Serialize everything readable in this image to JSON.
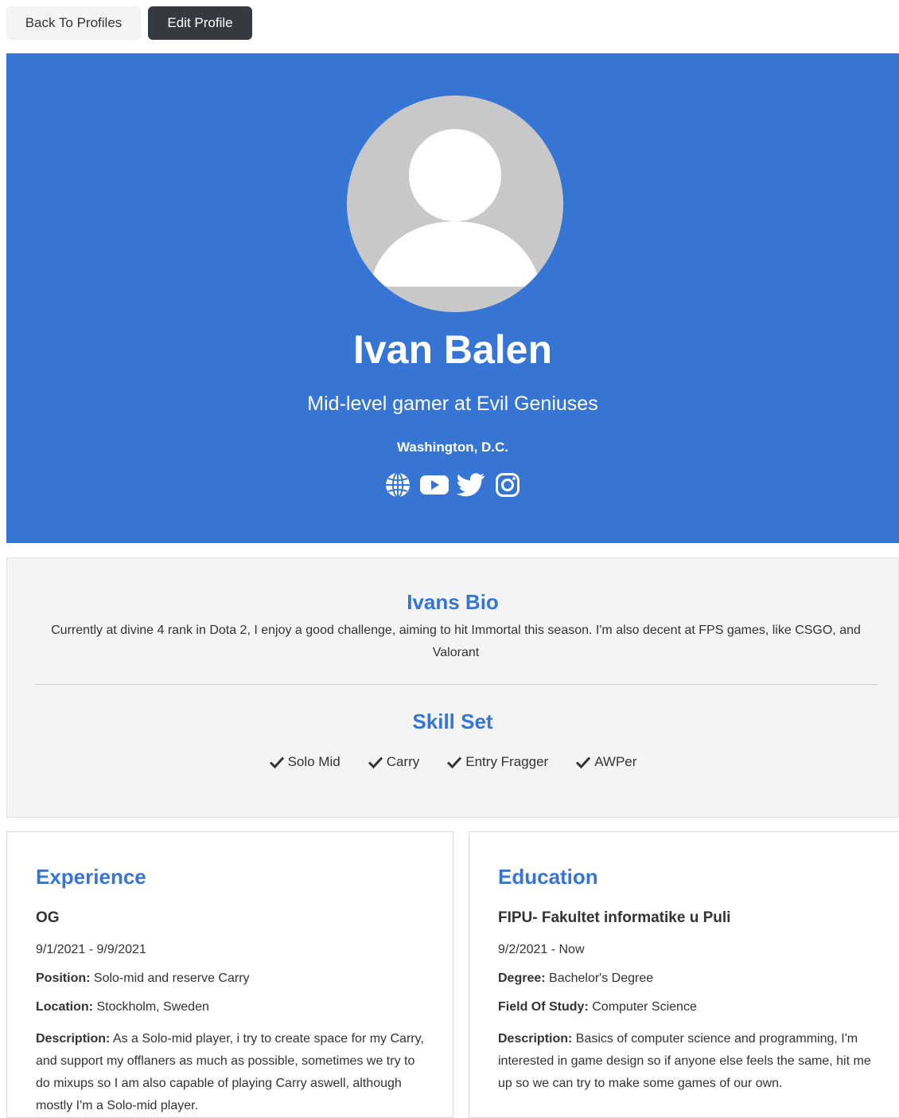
{
  "toolbar": {
    "back_label": "Back To Profiles",
    "edit_label": "Edit Profile"
  },
  "profile": {
    "name": "Ivan Balen",
    "title": "Mid-level gamer at Evil Geniuses",
    "location": "Washington, D.C.",
    "social_icons": [
      "globe-icon",
      "youtube-icon",
      "twitter-icon",
      "instagram-icon"
    ]
  },
  "about": {
    "bio_heading": "Ivans Bio",
    "bio_text": "Currently at divine 4 rank in Dota 2, I enjoy a good challenge, aiming to hit Immortal this season. I'm also decent at FPS games, like CSGO, and Valorant",
    "skills_heading": "Skill Set",
    "skills": [
      "Solo Mid",
      "Carry",
      "Entry Fragger",
      "AWPer"
    ]
  },
  "experience": {
    "heading": "Experience",
    "company": "OG",
    "dates": "9/1/2021 - 9/9/2021",
    "position_label": "Position:",
    "position": "Solo-mid and reserve Carry",
    "location_label": "Location:",
    "location": "Stockholm, Sweden",
    "description_label": "Description:",
    "description": "As a Solo-mid player, i try to create space for my Carry, and support my offlaners as much as possible, sometimes we try to do mixups so I am also capable of playing Carry aswell, although mostly I'm a Solo-mid player."
  },
  "education": {
    "heading": "Education",
    "school": "FIPU- Fakultet informatike u Puli",
    "dates": "9/2/2021 - Now",
    "degree_label": "Degree:",
    "degree": "Bachelor's Degree",
    "field_label": "Field Of Study:",
    "field": "Computer Science",
    "description_label": "Description:",
    "description": "Basics of computer science and programming, I'm interested in game design so if anyone else feels the same, hit me up so we can try to make some games of our own."
  },
  "colors": {
    "accent": "#3775d4",
    "dark_button": "#343a40",
    "panel": "#f4f4f4",
    "avatar_bg": "#c8c8c8"
  }
}
